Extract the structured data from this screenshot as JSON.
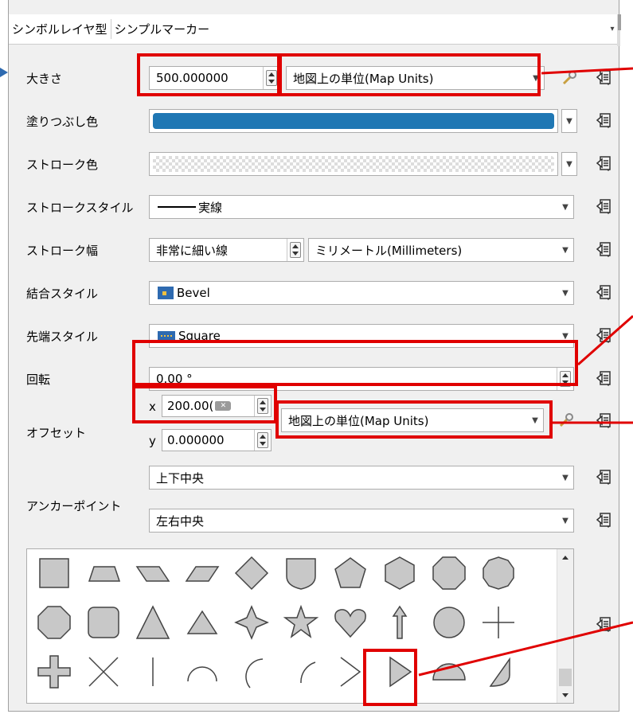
{
  "header": {
    "label": "シンボルレイヤ型",
    "value": "シンプルマーカー"
  },
  "size": {
    "label": "大きさ",
    "value": "500.000000",
    "unit": "地図上の単位(Map Units)"
  },
  "fill_color": {
    "label": "塗りつぶし色",
    "color": "#1f77b4"
  },
  "stroke_color": {
    "label": "ストローク色"
  },
  "stroke_style": {
    "label": "ストロークスタイル",
    "value": "実線"
  },
  "stroke_width": {
    "label": "ストローク幅",
    "value": "非常に細い線",
    "unit": "ミリメートル(Millimeters)"
  },
  "join_style": {
    "label": "結合スタイル",
    "value": "Bevel"
  },
  "cap_style": {
    "label": "先端スタイル",
    "value": "Square"
  },
  "rotation": {
    "label": "回転",
    "value": "0.00 °"
  },
  "offset": {
    "label": "オフセット",
    "x_label": "x",
    "x_value": "200.00(",
    "y_label": "y",
    "y_value": "0.000000",
    "unit": "地図上の単位(Map Units)"
  },
  "anchor": {
    "label": "アンカーポイント",
    "vertical": "上下中央",
    "horizontal": "左右中央"
  },
  "shapes": [
    "square",
    "trapezoid",
    "parallelogram",
    "parallelogram-slant",
    "diamond",
    "shield",
    "pentagon",
    "hexagon",
    "octagon",
    "decagon",
    "rounded-octagon",
    "rounded-square",
    "triangle",
    "equilateral-triangle",
    "four-point-star",
    "star",
    "heart",
    "arrow",
    "circle",
    "cross",
    "cross-fill",
    "x",
    "line",
    "semicircle",
    "third-circle",
    "quarter-circle",
    "arrowhead",
    "filled-arrowhead",
    "half-circle",
    "quarter-arc"
  ],
  "colors": {
    "accent_red": "#e00000",
    "fill_blue": "#1f77b4"
  }
}
